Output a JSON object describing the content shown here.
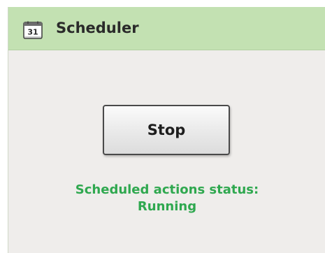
{
  "header": {
    "icon": "calendar-icon",
    "icon_day": "31",
    "title": "Scheduler"
  },
  "controls": {
    "stop_label": "Stop"
  },
  "status": {
    "line1": "Scheduled actions status:",
    "line2": "Running",
    "color": "#2fa84f"
  },
  "colors": {
    "header_bg": "#c3e1b2",
    "panel_bg": "#efedeb"
  }
}
